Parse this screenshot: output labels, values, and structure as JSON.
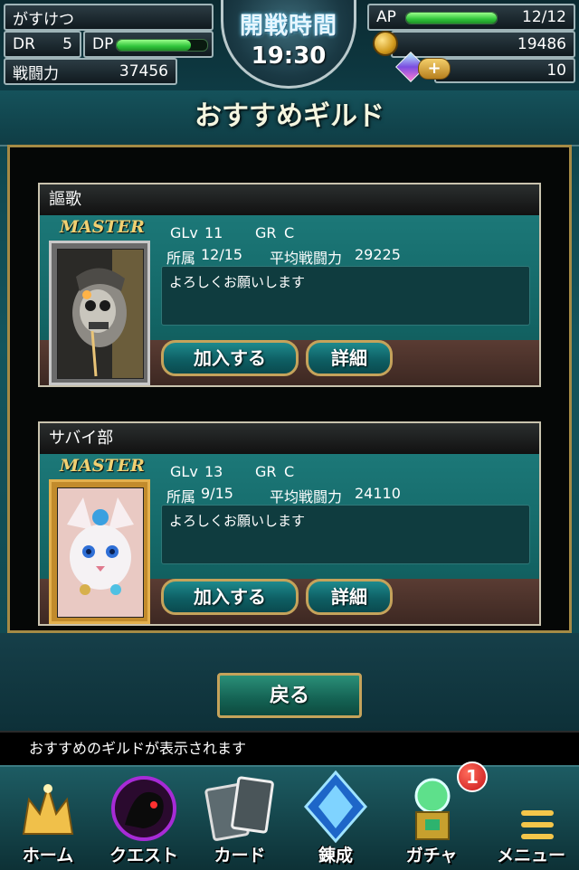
{
  "header": {
    "player_name": "がすけつ",
    "dr_label": "DR",
    "dr_value": "5",
    "dp_label": "DP",
    "dp_level": 0.82,
    "power_label": "戦闘力",
    "power_value": "37456",
    "battle_title": "開戦時間",
    "battle_time": "19:30",
    "ap_label": "AP",
    "ap_value": "12/12",
    "ap_level": 1.0,
    "coins": "19486",
    "gems": "10",
    "plus": "+"
  },
  "page_title": "おすすめギルド",
  "guilds": [
    {
      "name": "謳歌",
      "role": "MASTER",
      "glv_label": "GLv",
      "glv": "11",
      "gr_label": "GR",
      "gr": "C",
      "members_label": "所属",
      "members": "12/15",
      "avg_power_label": "平均戦闘力",
      "avg_power": "29225",
      "message": "よろしくお願いします",
      "join_label": "加入する",
      "detail_label": "詳細"
    },
    {
      "name": "サバイ部",
      "role": "MASTER",
      "glv_label": "GLv",
      "glv": "13",
      "gr_label": "GR",
      "gr": "C",
      "members_label": "所属",
      "members": "9/15",
      "avg_power_label": "平均戦闘力",
      "avg_power": "24110",
      "message": "よろしくお願いします",
      "join_label": "加入する",
      "detail_label": "詳細"
    }
  ],
  "back_label": "戻る",
  "status_message": "おすすめのギルドが表示されます",
  "nav": {
    "home": "ホーム",
    "quest": "クエスト",
    "card": "カード",
    "forge": "錬成",
    "gacha": "ガチャ",
    "gacha_badge": "1",
    "menu": "メニュー"
  }
}
